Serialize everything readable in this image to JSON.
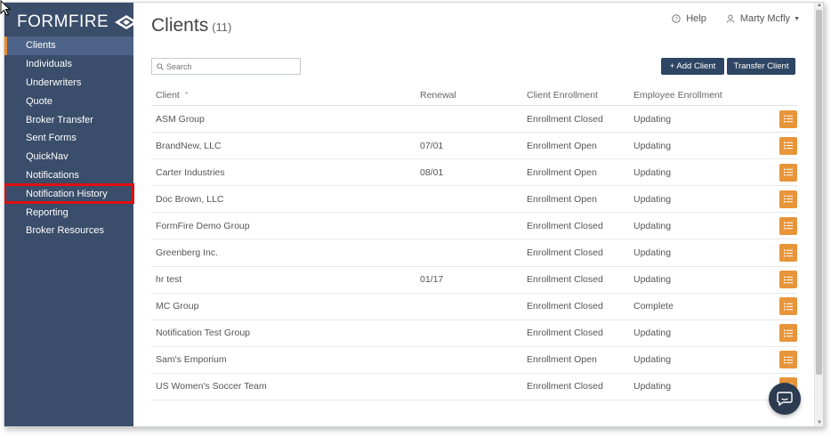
{
  "brand": {
    "name": "FORMFIRE"
  },
  "sidebar": {
    "items": [
      {
        "label": "Clients"
      },
      {
        "label": "Individuals"
      },
      {
        "label": "Underwriters"
      },
      {
        "label": "Quote"
      },
      {
        "label": "Broker Transfer"
      },
      {
        "label": "Sent Forms"
      },
      {
        "label": "QuickNav"
      },
      {
        "label": "Notifications"
      },
      {
        "label": "Notification History"
      },
      {
        "label": "Reporting"
      },
      {
        "label": "Broker Resources"
      }
    ],
    "active_index": 0,
    "highlighted_index": 8
  },
  "header": {
    "title": "Clients",
    "count": "(11)",
    "help_label": "Help",
    "user_label": "Marty Mcfly"
  },
  "search": {
    "placeholder": "Search"
  },
  "buttons": {
    "add_client": "+ Add Client",
    "transfer_client": "Transfer Client"
  },
  "table": {
    "headers": {
      "client": "Client",
      "renewal": "Renewal",
      "client_enrollment": "Client Enrollment",
      "employee_enrollment": "Employee Enrollment"
    },
    "rows": [
      {
        "client": "ASM Group",
        "renewal": "",
        "client_enrollment": "Enrollment Closed",
        "employee_enrollment": "Updating"
      },
      {
        "client": "BrandNew, LLC",
        "renewal": "07/01",
        "client_enrollment": "Enrollment Open",
        "employee_enrollment": "Updating"
      },
      {
        "client": "Carter Industries",
        "renewal": "08/01",
        "client_enrollment": "Enrollment Open",
        "employee_enrollment": "Updating"
      },
      {
        "client": "Doc Brown, LLC",
        "renewal": "",
        "client_enrollment": "Enrollment Open",
        "employee_enrollment": "Updating"
      },
      {
        "client": "FormFire Demo Group",
        "renewal": "",
        "client_enrollment": "Enrollment Closed",
        "employee_enrollment": "Updating"
      },
      {
        "client": "Greenberg Inc.",
        "renewal": "",
        "client_enrollment": "Enrollment Closed",
        "employee_enrollment": "Updating"
      },
      {
        "client": "hr test",
        "renewal": "01/17",
        "client_enrollment": "Enrollment Closed",
        "employee_enrollment": "Updating"
      },
      {
        "client": "MC Group",
        "renewal": "",
        "client_enrollment": "Enrollment Closed",
        "employee_enrollment": "Complete"
      },
      {
        "client": "Notification Test Group",
        "renewal": "",
        "client_enrollment": "Enrollment Closed",
        "employee_enrollment": "Updating"
      },
      {
        "client": "Sam's Emporium",
        "renewal": "",
        "client_enrollment": "Enrollment Open",
        "employee_enrollment": "Updating"
      },
      {
        "client": "US Women's Soccer Team",
        "renewal": "",
        "client_enrollment": "Enrollment Closed",
        "employee_enrollment": "Updating"
      }
    ]
  },
  "colors": {
    "sidebar": "#3a4d6a",
    "accent": "#e8953a",
    "button": "#2e4663",
    "highlight": "#e01010"
  }
}
